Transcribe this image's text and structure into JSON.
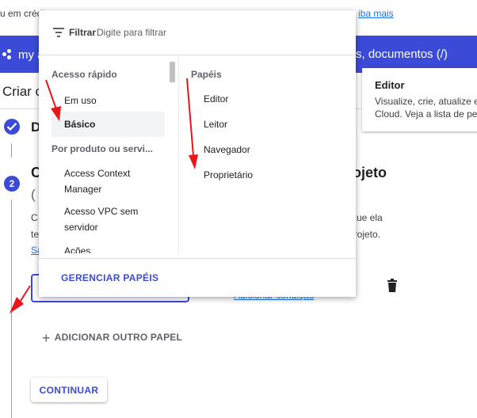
{
  "background": {
    "top_line_left": "u em crédi",
    "top_line_right": "iba mais",
    "project_label": "my a",
    "search_hint": "s, documentos (/)",
    "page_title": "Criar c",
    "step1_title": "D",
    "step2_number": "2",
    "step2_title_left": "C",
    "step2_title_right": "rojeto",
    "step2_subtitle": "(",
    "desc_line1_left": "C",
    "desc_line1_right": "ue ela",
    "desc_line2_left": "te",
    "desc_line2_right": "projeto.",
    "desc_line3_left": "Sa",
    "add_condition": "Adicionar condição",
    "add_role_label": "ADICIONAR OUTRO PAPEL",
    "continue_label": "CONTINUAR"
  },
  "tooltip": {
    "title": "Editor",
    "line1": "Visualize, crie, atualize e",
    "line2": "Cloud. Veja a lista de per"
  },
  "dropdown": {
    "filter_label": "Filtrar",
    "filter_placeholder": "Digite para filtrar",
    "left_column": {
      "section_quick": "Acesso rápido",
      "quick_items": [
        "Em uso",
        "Básico"
      ],
      "section_product": "Por produto ou servi...",
      "product_items": [
        "Access Context",
        "Manager",
        "Acesso VPC sem",
        "servidor",
        "Ações"
      ]
    },
    "right_column": {
      "title": "Papéis",
      "items": [
        "Editor",
        "Leitor",
        "Navegador",
        "Proprietário"
      ]
    },
    "manage_roles": "GERENCIAR PAPÉIS"
  },
  "colors": {
    "accent": "#3b4bd8",
    "link": "#1a73e8",
    "selected_row": "#f1f3f4",
    "annotation_arrow": "#e8161b"
  },
  "icons": [
    "filter-icon",
    "check-icon",
    "trash-icon",
    "plus-icon",
    "app-logo-icon"
  ]
}
